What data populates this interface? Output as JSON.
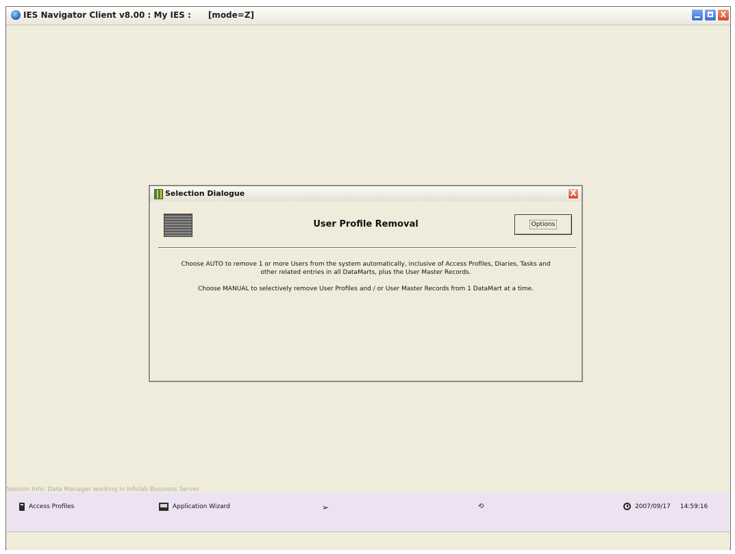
{
  "window": {
    "title": "IES Navigator Client v8.00 : My IES :      [mode=Z]",
    "buttons": {
      "minimize": "minimize",
      "maximize": "maximize",
      "close": "X"
    }
  },
  "dialog": {
    "title": "Selection Dialogue",
    "close": "X",
    "heading": "User Profile Removal",
    "options_button": "Options",
    "paragraph1": "Choose AUTO to remove 1 or more Users from the system automatically, inclusive of Access Profiles, Diaries, Tasks and other related entries in all DataMarts, plus the User Master Records.",
    "paragraph2": "Choose MANUAL to selectively remove User Profiles and / or User Master Records from 1 DataMart at a time."
  },
  "status": {
    "session_info": "Session Info: Data Manager working in Infolab Business Server",
    "items": [
      {
        "label": "Access Profiles",
        "icon": "book-icon"
      },
      {
        "label": "Application Wizard",
        "icon": "wizard-icon"
      }
    ],
    "date": "2007/09/17",
    "time": "14:59:16"
  },
  "colors": {
    "window_bg": "#efecdb",
    "statusbar_bg": "#ece2f2",
    "close_red": "#d24a2c"
  }
}
